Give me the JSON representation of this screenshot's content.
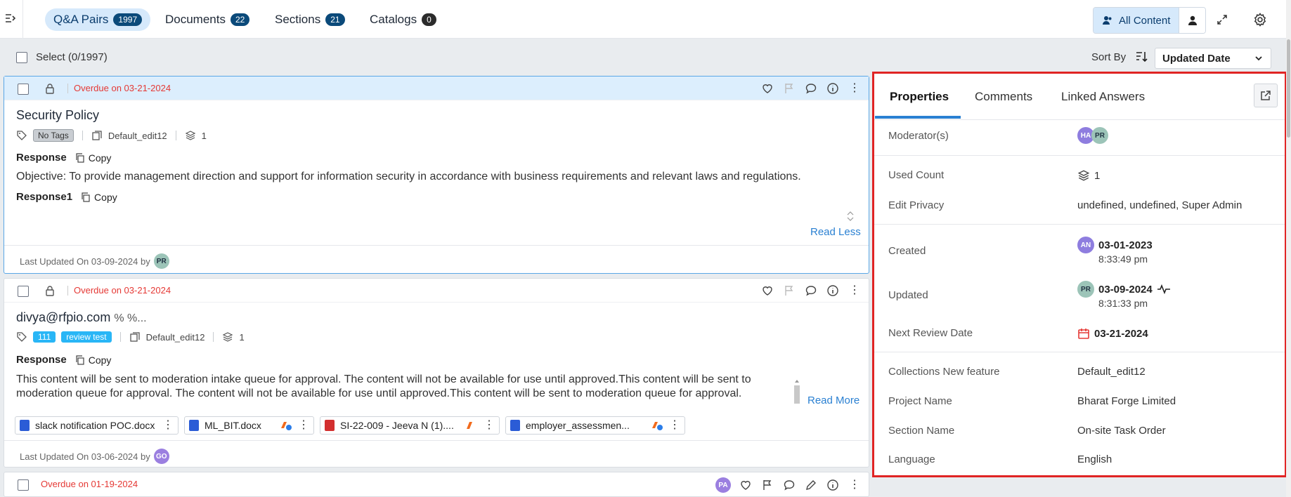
{
  "tabs": [
    {
      "label": "Q&A Pairs",
      "count": "1997"
    },
    {
      "label": "Documents",
      "count": "22"
    },
    {
      "label": "Sections",
      "count": "21"
    },
    {
      "label": "Catalogs",
      "count": "0"
    }
  ],
  "header": {
    "all_content_label": "All Content"
  },
  "toolbar": {
    "select_label": "Select (0/1997)",
    "sort_label": "Sort By",
    "sort_value": "Updated Date"
  },
  "cards": [
    {
      "overdue": "Overdue on 03-21-2024",
      "title": "Security Policy",
      "tags": [
        "No Tags"
      ],
      "collection": "Default_edit12",
      "used_count": "1",
      "response_label": "Response",
      "copy_label": "Copy",
      "response_text": "Objective: To provide management direction and support for information security in accordance with business requirements and relevant laws and regulations.",
      "response1_label": "Response1",
      "toggle_label": "Read Less",
      "footer": "Last Updated On 03-09-2024 by",
      "footer_avatar": "PR"
    },
    {
      "overdue": "Overdue on 03-21-2024",
      "title": "divya@rfpio.com",
      "title_suffix": "% %...",
      "tags": [
        "111",
        "review test"
      ],
      "collection": "Default_edit12",
      "used_count": "1",
      "response_label": "Response",
      "copy_label": "Copy",
      "response_text": "This content will be sent to moderation intake queue for approval. The content will not be available for use until approved.This content will be sent to moderation queue for approval. The content will not be available for use until approved.This content will be sent to moderation queue for approval.",
      "toggle_label": "Read More",
      "attachments": [
        "slack notification POC.docx",
        "ML_BIT.docx",
        "SI-22-009 - Jeeva N (1)....",
        "employer_assessmen..."
      ],
      "footer": "Last Updated On 03-06-2024 by",
      "footer_avatar": "GO"
    },
    {
      "overdue": "Overdue on 01-19-2024",
      "head_avatar": "PA"
    }
  ],
  "panel": {
    "tabs": [
      "Properties",
      "Comments",
      "Linked Answers"
    ],
    "moderators_label": "Moderator(s)",
    "moderators": [
      "HA",
      "PR"
    ],
    "used_count_label": "Used Count",
    "used_count": "1",
    "edit_privacy_label": "Edit Privacy",
    "edit_privacy": "undefined, undefined, Super Admin",
    "created_label": "Created",
    "created_avatar": "AN",
    "created_date": "03-01-2023",
    "created_time": "8:33:49 pm",
    "updated_label": "Updated",
    "updated_avatar": "PR",
    "updated_date": "03-09-2024",
    "updated_time": "8:31:33 pm",
    "next_review_label": "Next Review Date",
    "next_review": "03-21-2024",
    "collections_label": "Collections New feature",
    "collections": "Default_edit12",
    "project_label": "Project Name",
    "project": "Bharat Forge Limited",
    "section_label": "Section Name",
    "section": "On-site Task Order",
    "language_label": "Language",
    "language": "English"
  },
  "colors": {
    "accent": "#2a80d2",
    "overdue": "#e53935",
    "highlight_border": "#e02424",
    "badge": "#0b4a7a"
  }
}
